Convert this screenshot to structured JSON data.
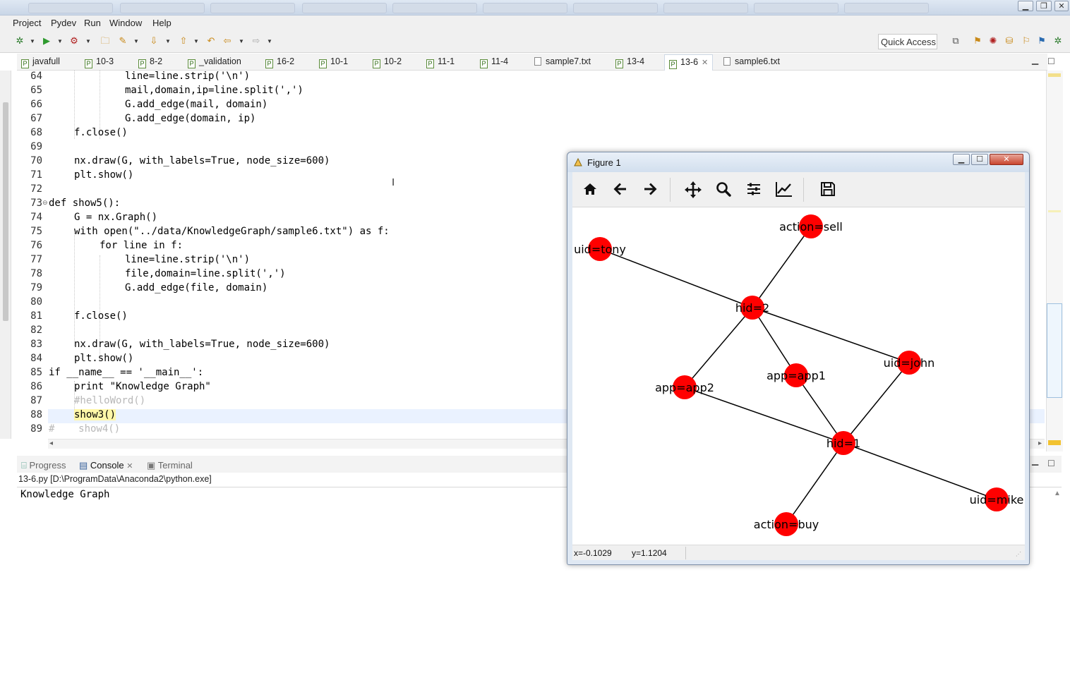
{
  "menu": [
    "Project",
    "Pydev",
    "Run",
    "Window",
    "Help"
  ],
  "quick_access": "Quick Access",
  "editor_tabs": [
    {
      "label": "javafull",
      "kind": "py"
    },
    {
      "label": "10-3",
      "kind": "py"
    },
    {
      "label": "8-2",
      "kind": "py"
    },
    {
      "label": "_validation",
      "kind": "py"
    },
    {
      "label": "16-2",
      "kind": "py"
    },
    {
      "label": "10-1",
      "kind": "py"
    },
    {
      "label": "10-2",
      "kind": "py"
    },
    {
      "label": "11-1",
      "kind": "py"
    },
    {
      "label": "11-4",
      "kind": "py"
    },
    {
      "label": "sample7.txt",
      "kind": "txt"
    },
    {
      "label": "13-4",
      "kind": "py"
    },
    {
      "label": "13-6",
      "kind": "py",
      "active": true
    },
    {
      "label": "sample6.txt",
      "kind": "txt"
    }
  ],
  "code_lines": [
    {
      "n": "64",
      "text": "line=line.strip('\\n')"
    },
    {
      "n": "65",
      "text": "mail,domain,ip=line.split(',')"
    },
    {
      "n": "66",
      "text": "G.add_edge(mail, domain)"
    },
    {
      "n": "67",
      "text": "G.add_edge(domain, ip)"
    },
    {
      "n": "68",
      "text": "f.close()"
    },
    {
      "n": "69",
      "text": ""
    },
    {
      "n": "70",
      "text": "nx.draw(G, with_labels=True, node_size=600)"
    },
    {
      "n": "71",
      "text": "plt.show()"
    },
    {
      "n": "72",
      "text": ""
    },
    {
      "n": "73",
      "text": "def show5():"
    },
    {
      "n": "74",
      "text": "G = nx.Graph()"
    },
    {
      "n": "75",
      "text": "with open(\"../data/KnowledgeGraph/sample6.txt\") as f:"
    },
    {
      "n": "76",
      "text": "for line in f:"
    },
    {
      "n": "77",
      "text": "line=line.strip('\\n')"
    },
    {
      "n": "78",
      "text": "file,domain=line.split(',')"
    },
    {
      "n": "79",
      "text": "G.add_edge(file, domain)"
    },
    {
      "n": "80",
      "text": ""
    },
    {
      "n": "81",
      "text": "f.close()"
    },
    {
      "n": "82",
      "text": ""
    },
    {
      "n": "83",
      "text": "nx.draw(G, with_labels=True, node_size=600)"
    },
    {
      "n": "84",
      "text": "plt.show()"
    },
    {
      "n": "85",
      "text": "if __name__ == '__main__':"
    },
    {
      "n": "86",
      "text": "print \"Knowledge Graph\""
    },
    {
      "n": "87",
      "text": "#helloWord()"
    },
    {
      "n": "88",
      "text": "show3()"
    },
    {
      "n": "89",
      "text": "#    show4()"
    }
  ],
  "bottom_tabs": {
    "progress": "Progress",
    "console": "Console",
    "terminal": "Terminal"
  },
  "console": {
    "path": "13-6.py [D:\\ProgramData\\Anaconda2\\python.exe]",
    "output": "Knowledge Graph"
  },
  "figure": {
    "title": "Figure 1",
    "status_x": "x=-0.1029",
    "status_y": "y=1.1204",
    "toolbar_icons": [
      "home-icon",
      "back-icon",
      "forward-icon",
      "pan-icon",
      "zoom-icon",
      "configure-subplots-icon",
      "edit-axis-icon",
      "save-icon"
    ],
    "node_color": "#ff0000",
    "edge_color": "#000000",
    "nodes": [
      {
        "id": "action=sell"
      },
      {
        "id": "uid=tony"
      },
      {
        "id": "hid=2"
      },
      {
        "id": "uid=john"
      },
      {
        "id": "app=app1"
      },
      {
        "id": "app=app2"
      },
      {
        "id": "hid=1"
      },
      {
        "id": "uid=mike"
      },
      {
        "id": "action=buy"
      }
    ],
    "edges": [
      [
        "uid=tony",
        "hid=2"
      ],
      [
        "action=sell",
        "hid=2"
      ],
      [
        "hid=2",
        "uid=john"
      ],
      [
        "hid=2",
        "app=app1"
      ],
      [
        "hid=2",
        "app=app2"
      ],
      [
        "app=app2",
        "hid=1"
      ],
      [
        "app=app1",
        "hid=1"
      ],
      [
        "uid=john",
        "hid=1"
      ],
      [
        "hid=1",
        "uid=mike"
      ],
      [
        "hid=1",
        "action=buy"
      ]
    ]
  }
}
